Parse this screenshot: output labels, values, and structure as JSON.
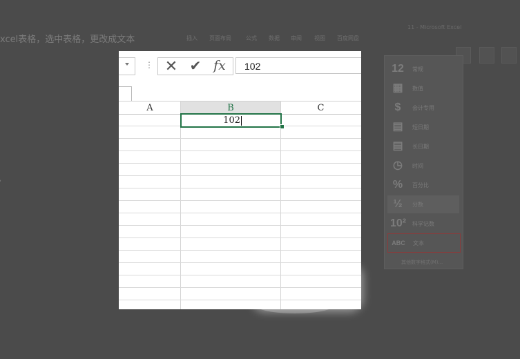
{
  "background": {
    "caption": "xcel表格，选中表格，更改成文本",
    "window_title": "11 - Microsoft Excel",
    "ribbon_tabs": [
      "插入",
      "页面布局",
      "公式",
      "数据",
      "审阅",
      "视图",
      "百度网盘"
    ],
    "format_menu": {
      "items": [
        {
          "icon": "12",
          "label": "常规"
        },
        {
          "icon": "▦",
          "label": "数值"
        },
        {
          "icon": "$",
          "label": "会计专用"
        },
        {
          "icon": "▤",
          "label": "短日期"
        },
        {
          "icon": "▤",
          "label": "长日期"
        },
        {
          "icon": "◷",
          "label": "时间"
        },
        {
          "icon": "%",
          "label": "百分比"
        },
        {
          "icon": "½",
          "label": "分数"
        },
        {
          "icon": "10²",
          "label": "科学记数"
        },
        {
          "icon": "ABC",
          "label": "文本"
        }
      ],
      "footer": "其他数字格式(M)..."
    }
  },
  "formula_bar": {
    "cancel_symbol": "✕",
    "enter_symbol": "✔",
    "fx_label": "fx",
    "value": "102"
  },
  "sheet": {
    "columns": [
      "A",
      "B",
      "C"
    ],
    "active_cell_value": "102"
  },
  "colors": {
    "excel_green": "#217346",
    "overlay": "#4b4b4b"
  }
}
